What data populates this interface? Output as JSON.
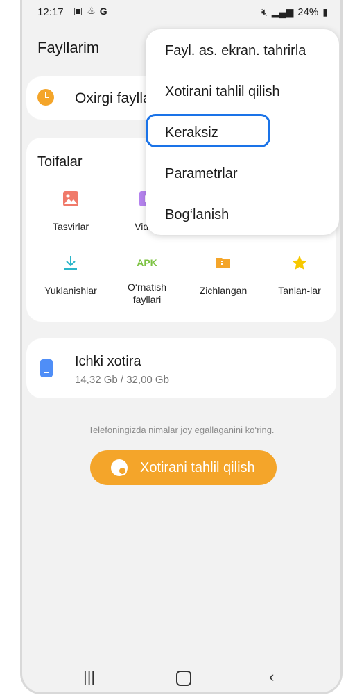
{
  "status": {
    "time": "12:17",
    "battery": "24%"
  },
  "header": {
    "title": "Fayllarim"
  },
  "recent": {
    "label": "Oxirgi fayllar"
  },
  "categories": {
    "heading": "Toifalar",
    "items": [
      {
        "label": "Tasvirlar",
        "icon": "image-icon",
        "color": "#f07a6a"
      },
      {
        "label": "Video",
        "icon": "video-icon",
        "color": "#b684f0"
      },
      {
        "label": "Yuklanishlar",
        "icon": "download-icon",
        "color": "#2bb5c9"
      },
      {
        "label": "O‘rnatish\nfayllari",
        "icon": "apk-icon",
        "icon_text": "APK",
        "color": "#7cc242"
      },
      {
        "label": "Zichlangan",
        "icon": "archive-icon",
        "color": "#f4a52a"
      },
      {
        "label": "Tanlan-lar",
        "icon": "star-icon",
        "color": "#f7c800"
      }
    ]
  },
  "storage": {
    "name": "Ichki xotira",
    "size": "14,32 Gb / 32,00 Gb",
    "icon": "phone-icon",
    "color": "#4f8ef7"
  },
  "hint": "Telefoningizda nimalar joy egallaganini ko‘ring.",
  "analyze_button": {
    "label": "Xotirani tahlil qilish",
    "color": "#f4a52a"
  },
  "menu": {
    "items": [
      "Fayl. as. ekran. tahrirla",
      "Xotirani tahlil qilish",
      "Keraksiz",
      "Parametrlar",
      "Bog‘lanish"
    ],
    "highlighted_index": 2,
    "highlight_color": "#1a73e8"
  }
}
